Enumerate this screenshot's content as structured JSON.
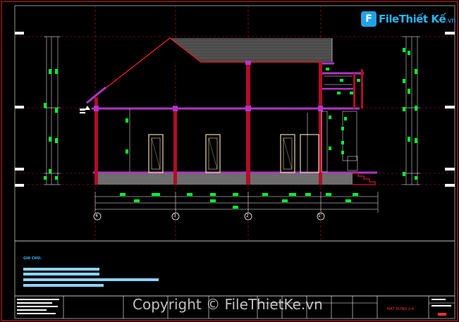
{
  "logo": {
    "text_main": "File",
    "text_bold": "Thiết Kế",
    "text_tld": ".vn"
  },
  "notes": {
    "title": "GHI CHÚ:"
  },
  "axes": [
    "4",
    "3",
    "2",
    "1'"
  ],
  "watermark": "Copyright © FileThietKe.vn",
  "titleblock": {
    "drawing_title": "MẶT ĐỨNG 2-4"
  },
  "colors": {
    "frame": "#e23030",
    "structure": "#b10d2a",
    "slab": "#b433c8",
    "dim": "#00ff2a",
    "note": "#8fd3ff"
  }
}
